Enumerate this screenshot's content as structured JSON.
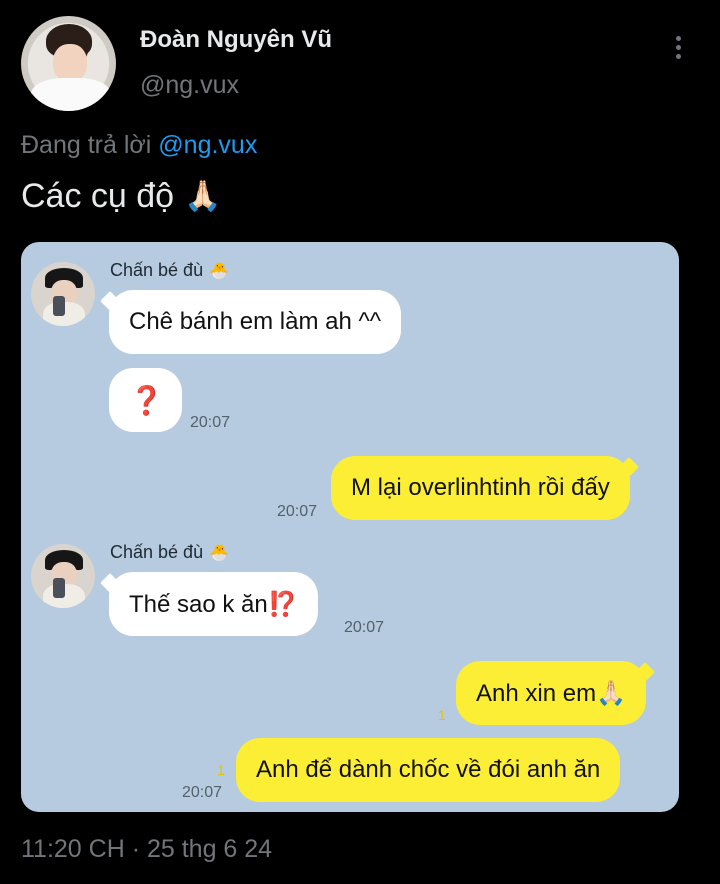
{
  "tweet": {
    "author_name": "Đoàn Nguyên Vũ",
    "author_handle": "@ng.vux",
    "reply_prefix": "Đang trả lời",
    "reply_to": "@ng.vux",
    "text": "Các cụ độ",
    "text_emoji": "🙏🏻",
    "timestamp": "11:20 CH · 25 thg 6 24"
  },
  "chat": {
    "sender_name": "Chấn bé đù",
    "sender_emoji": "🐣",
    "messages": [
      {
        "text": "Chê bánh em làm ah ^^"
      },
      {
        "text": "❓",
        "time": "20:07"
      },
      {
        "text": "M lại overlinhtinh rồi đấy",
        "time": "20:07"
      },
      {
        "text": "Thế sao k ăn⁉️",
        "time": "20:07"
      },
      {
        "text": "Anh xin em🙏🏻",
        "unread": "1"
      },
      {
        "text": "Anh để dành chốc về đói anh ăn",
        "time": "20:07",
        "unread": "1"
      }
    ]
  }
}
